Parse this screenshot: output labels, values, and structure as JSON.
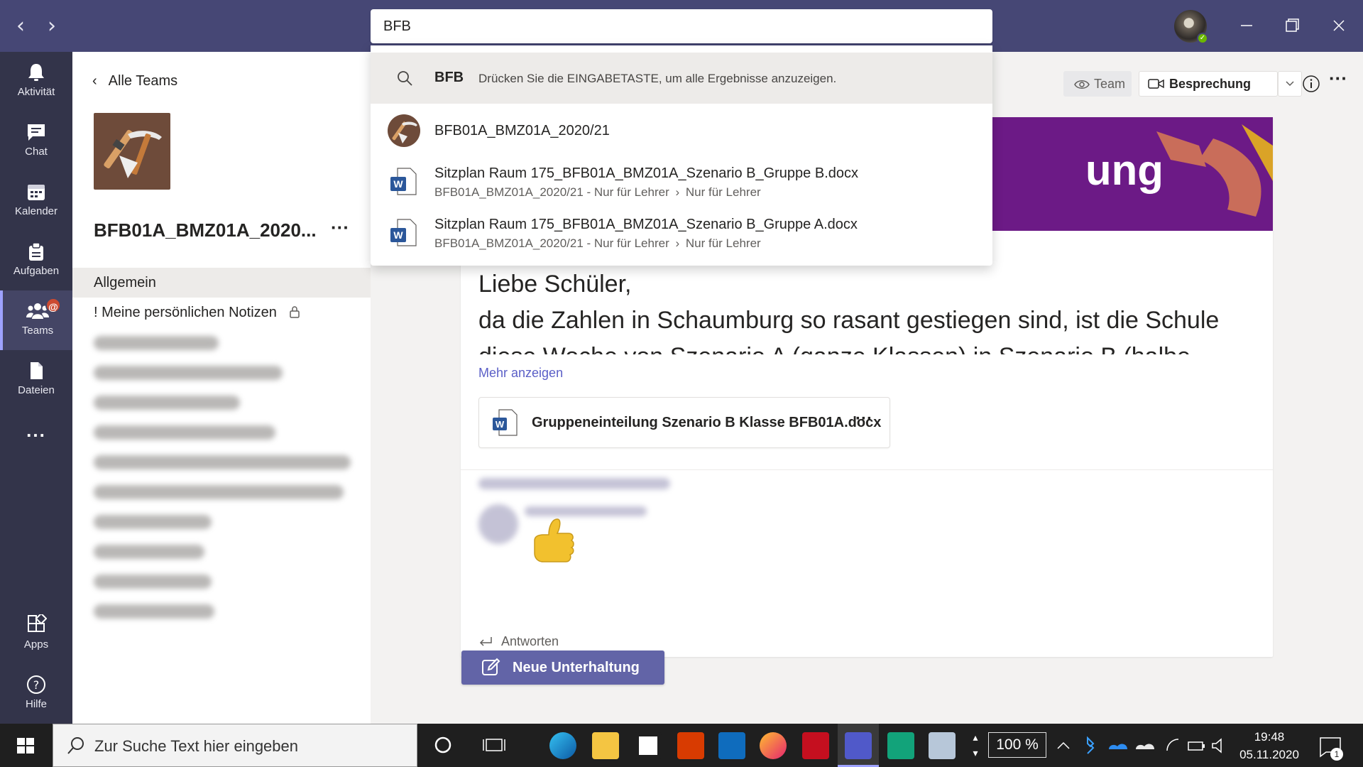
{
  "titlebar": {
    "search_value": "BFB",
    "back_label": "‹",
    "forward_label": "›"
  },
  "rail": {
    "items": [
      {
        "label": "Aktivität",
        "icon": "bell-icon"
      },
      {
        "label": "Chat",
        "icon": "chat-icon"
      },
      {
        "label": "Kalender",
        "icon": "calendar-icon"
      },
      {
        "label": "Aufgaben",
        "icon": "assignments-icon"
      },
      {
        "label": "Teams",
        "icon": "teams-icon",
        "active": true,
        "badge": "@"
      },
      {
        "label": "Dateien",
        "icon": "files-icon"
      },
      {
        "label": "...",
        "icon": "more-icon"
      },
      {
        "label": "Apps",
        "icon": "apps-icon"
      },
      {
        "label": "Hilfe",
        "icon": "help-icon"
      }
    ]
  },
  "channels": {
    "back_label": "Alle Teams",
    "team_name": "BFB01A_BMZ01A_2020...",
    "more_label": "···",
    "items": [
      {
        "label": "Allgemein",
        "selected": true
      },
      {
        "label": "! Meine persönlichen Notizen",
        "locked": true
      }
    ]
  },
  "header": {
    "team_label": "Team",
    "meeting_label": "Besprechung"
  },
  "post": {
    "banner_text": "ung",
    "line1": "Liebe Schüler,",
    "line2": "da die Zahlen in Schaumburg so rasant gestiegen sind, ist die Schule",
    "line3": "diese Woche von Szenario A (ganze Klassen) in Szenario B (halbe",
    "more_link": "Mehr anzeigen",
    "attachment": "Gruppeneinteilung Szenario B Klasse BFB01A.docx",
    "attachment_more": "···",
    "reply_label": "Antworten"
  },
  "new_conversation_label": "Neue Unterhaltung",
  "search_dropdown": {
    "query": "BFB",
    "hint": "Drücken Sie die EINGABETASTE, um alle Ergebnisse anzuzeigen.",
    "results": [
      {
        "title": "BFB01A_BMZ01A_2020/21",
        "type": "team"
      },
      {
        "title": "Sitzplan Raum 175_BFB01A_BMZ01A_Szenario B_Gruppe B.docx",
        "path_team": "BFB01A_BMZ01A_2020/21 - Nur für Lehrer",
        "path_folder": "Nur für Lehrer",
        "type": "word"
      },
      {
        "title": "Sitzplan Raum 175_BFB01A_BMZ01A_Szenario B_Gruppe A.docx",
        "path_team": "BFB01A_BMZ01A_2020/21 - Nur für Lehrer",
        "path_folder": "Nur für Lehrer",
        "type": "word"
      }
    ]
  },
  "taskbar": {
    "search_placeholder": "Zur Suche Text hier eingeben",
    "zoom": "100 %",
    "time": "19:48",
    "date": "05.11.2020",
    "notification_count": "1"
  },
  "colors": {
    "titlebar": "#464775",
    "rail": "#33344a",
    "accent": "#6264a7",
    "banner": "#7a1f93"
  }
}
